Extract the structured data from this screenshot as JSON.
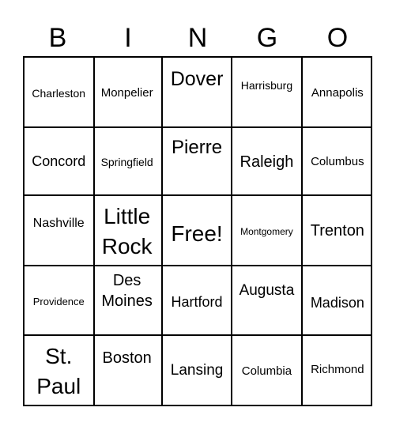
{
  "header": [
    "B",
    "I",
    "N",
    "G",
    "O"
  ],
  "cells": [
    [
      "Charleston",
      "Monpelier",
      "Dover",
      "Harrisburg",
      "Annapolis"
    ],
    [
      "Concord",
      "Springfield",
      "Pierre",
      "Raleigh",
      "Columbus"
    ],
    [
      "Nashville",
      "Little Rock",
      "Free!",
      "Montgomery",
      "Trenton"
    ],
    [
      "Providence",
      "Des Moines",
      "Hartford",
      "Augusta",
      "Madison"
    ],
    [
      "St. Paul",
      "Boston",
      "Lansing",
      "Columbia",
      "Richmond"
    ]
  ]
}
